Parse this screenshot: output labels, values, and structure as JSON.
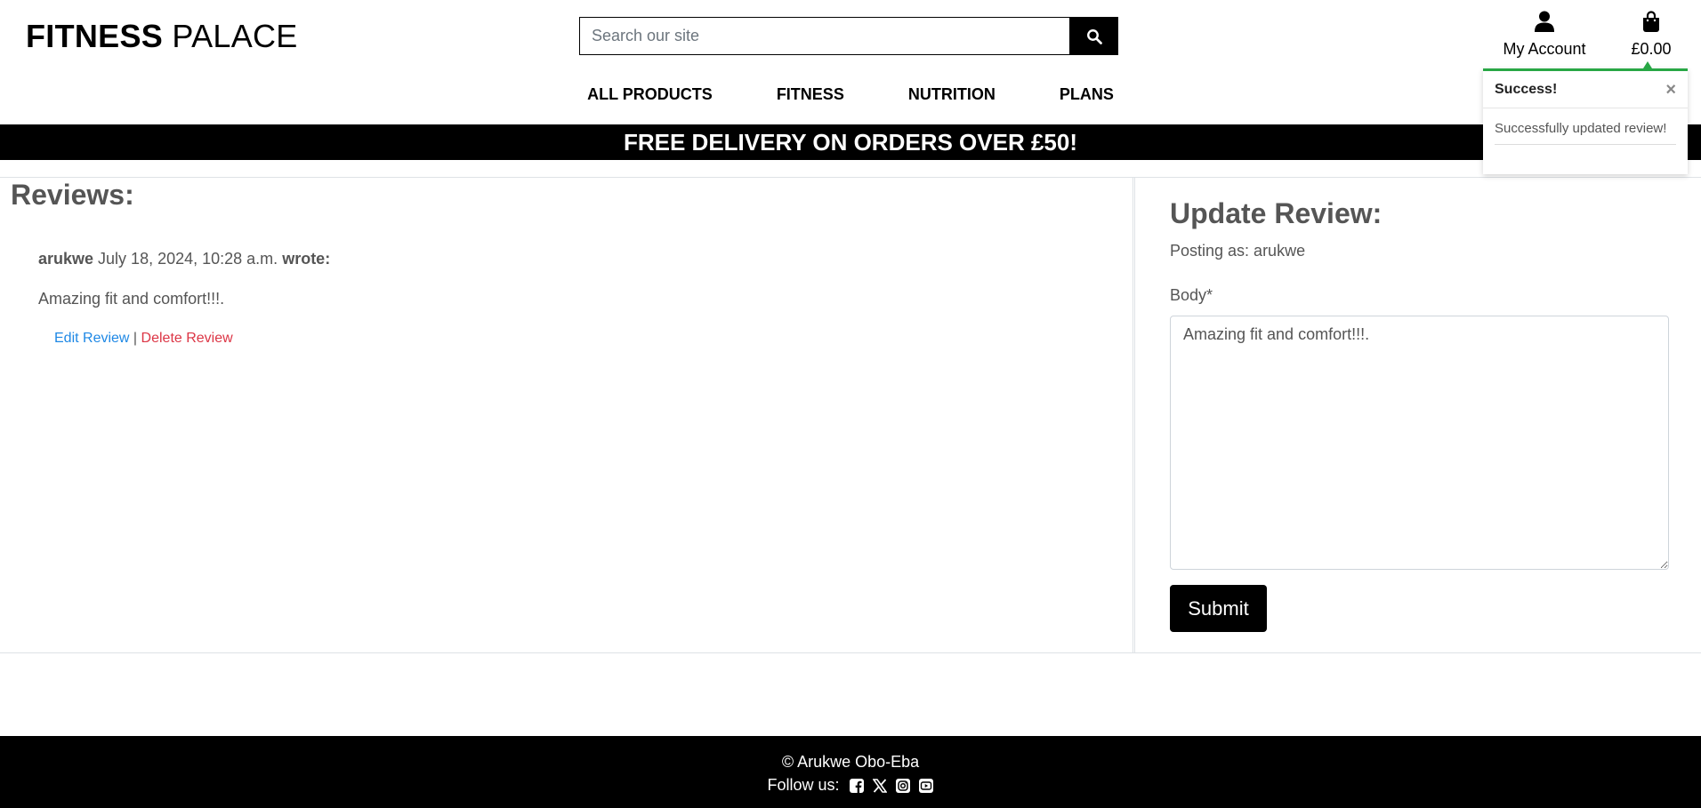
{
  "header": {
    "logo_bold": "FITNESS",
    "logo_rest": " PALACE",
    "search_placeholder": "Search our site",
    "account_label": "My Account",
    "cart_total": "£0.00"
  },
  "nav": {
    "items": [
      {
        "label": "ALL PRODUCTS"
      },
      {
        "label": "FITNESS"
      },
      {
        "label": "NUTRITION"
      },
      {
        "label": "PLANS"
      }
    ]
  },
  "banner": {
    "text": "FREE DELIVERY ON ORDERS OVER £50!"
  },
  "toast": {
    "title": "Success!",
    "close": "×",
    "message": "Successfully updated review!",
    "accent": "#28a745"
  },
  "reviews": {
    "heading": "Reviews:",
    "items": [
      {
        "author": "arukwe",
        "date": " July 18, 2024, 10:28 a.m. ",
        "wrote": "wrote:",
        "body": "Amazing fit and comfort!!!.",
        "edit_label": "Edit Review",
        "separator": " | ",
        "delete_label": "Delete Review"
      }
    ]
  },
  "update_form": {
    "heading": "Update Review:",
    "posting_as": "Posting as: arukwe",
    "body_label": "Body*",
    "body_value": "Amazing fit and comfort!!!.",
    "submit_label": "Submit"
  },
  "footer": {
    "copyright": "© Arukwe Obo-Eba",
    "follow_label": "Follow us:",
    "social_icons": [
      "facebook-icon",
      "x-twitter-icon",
      "instagram-icon",
      "youtube-icon"
    ]
  },
  "colors": {
    "link_edit": "#1e88e5",
    "link_delete": "#dc3545",
    "banner_bg": "#000000"
  }
}
